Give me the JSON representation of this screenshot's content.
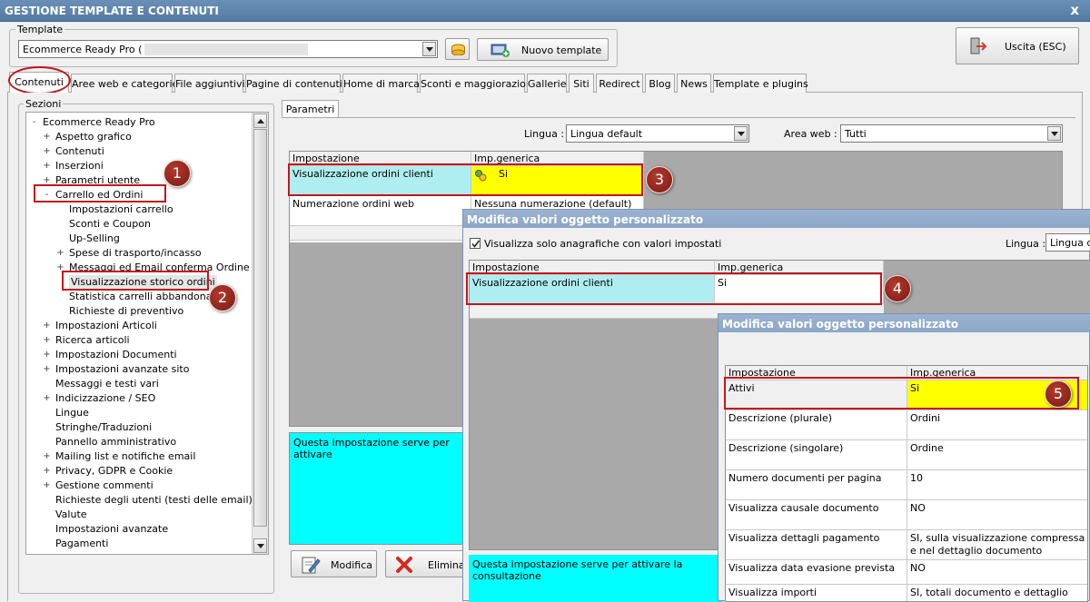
{
  "window": {
    "title": "GESTIONE TEMPLATE E CONTENUTI",
    "close": "x"
  },
  "template": {
    "label": "Template",
    "value": "Ecommerce Ready Pro (",
    "new_template": "Nuovo template",
    "exit": "Uscita (ESC)"
  },
  "tabs": [
    "Contenuti",
    "Aree web e categorie",
    "File aggiuntivi",
    "Pagine di contenuti",
    "Home di marca",
    "Sconti e maggiorazioni",
    "Gallerie",
    "Siti",
    "Redirect",
    "Blog",
    "News",
    "Template e plugins"
  ],
  "sections": {
    "label": "Sezioni",
    "items": [
      {
        "text": "Ecommerce Ready Pro",
        "level": 0,
        "exp": "-"
      },
      {
        "text": "Aspetto grafico",
        "level": 1,
        "exp": "+"
      },
      {
        "text": "Contenuti",
        "level": 1,
        "exp": "+"
      },
      {
        "text": "Inserzioni",
        "level": 1,
        "exp": "+"
      },
      {
        "text": "Parametri utente",
        "level": 1,
        "exp": "+"
      },
      {
        "text": "Carrello ed Ordini",
        "level": 1,
        "exp": "-"
      },
      {
        "text": "Impostazioni carrello",
        "level": 2,
        "exp": ""
      },
      {
        "text": "Sconti e Coupon",
        "level": 2,
        "exp": ""
      },
      {
        "text": "Up-Selling",
        "level": 2,
        "exp": ""
      },
      {
        "text": "Spese di trasporto/incasso",
        "level": 2,
        "exp": "+"
      },
      {
        "text": "Messaggi ed Email conferma Ordine",
        "level": 2,
        "exp": "+"
      },
      {
        "text": "Visualizzazione storico ordini",
        "level": 2,
        "exp": ""
      },
      {
        "text": "Statistica carrelli abbandonati",
        "level": 2,
        "exp": ""
      },
      {
        "text": "Richieste di preventivo",
        "level": 2,
        "exp": ""
      },
      {
        "text": "Impostazioni Articoli",
        "level": 1,
        "exp": "+"
      },
      {
        "text": "Ricerca articoli",
        "level": 1,
        "exp": "+"
      },
      {
        "text": "Impostazioni Documenti",
        "level": 1,
        "exp": "+"
      },
      {
        "text": "Impostazioni avanzate sito",
        "level": 1,
        "exp": "+"
      },
      {
        "text": "Messaggi e testi vari",
        "level": 1,
        "exp": ""
      },
      {
        "text": "Indicizzazione / SEO",
        "level": 1,
        "exp": "+"
      },
      {
        "text": "Lingue",
        "level": 1,
        "exp": ""
      },
      {
        "text": "Stringhe/Traduzioni",
        "level": 1,
        "exp": ""
      },
      {
        "text": "Pannello amministrativo",
        "level": 1,
        "exp": ""
      },
      {
        "text": "Mailing list e notifiche email",
        "level": 1,
        "exp": "+"
      },
      {
        "text": "Privacy, GDPR e Cookie",
        "level": 1,
        "exp": "+"
      },
      {
        "text": "Gestione commenti",
        "level": 1,
        "exp": "+"
      },
      {
        "text": "Richieste degli utenti (testi delle email)",
        "level": 1,
        "exp": ""
      },
      {
        "text": "Valute",
        "level": 1,
        "exp": ""
      },
      {
        "text": "Impostazioni avanzate",
        "level": 1,
        "exp": ""
      },
      {
        "text": "Pagamenti",
        "level": 1,
        "exp": ""
      }
    ]
  },
  "params": {
    "tab": "Parametri",
    "lingua_label": "Lingua :",
    "lingua_value": "Lingua default",
    "area_label": "Area web :",
    "area_value": "Tutti",
    "col_setting": "Impostazione",
    "col_generic": "Imp.generica",
    "rows": [
      {
        "setting": "Visualizzazione ordini clienti",
        "value": "Si"
      },
      {
        "setting": "Numerazione ordini web",
        "value": "Nessuna numerazione (default)"
      }
    ],
    "description": "Questa impostazione serve per attivare",
    "modify": "Modifica",
    "delete": "Elimina"
  },
  "dialog1": {
    "title": "Modifica valori oggetto personalizzato",
    "checkbox": "Visualizza solo anagrafiche con valori impostati",
    "lingua_label": "Lingua :",
    "lingua_value": "Lingua de",
    "col_setting": "Impostazione",
    "col_generic": "Imp.generica",
    "row_setting": "Visualizzazione ordini clienti",
    "row_value": "Si",
    "description": "Questa impostazione serve per attivare la consultazione"
  },
  "dialog2": {
    "title": "Modifica valori oggetto personalizzato",
    "col_setting": "Impostazione",
    "col_generic": "Imp.generica",
    "rows": [
      {
        "setting": "Attivi",
        "value": "Si"
      },
      {
        "setting": "Descrizione (plurale)",
        "value": "Ordini"
      },
      {
        "setting": "Descrizione (singolare)",
        "value": "Ordine"
      },
      {
        "setting": "Numero documenti per pagina",
        "value": "10"
      },
      {
        "setting": "Visualizza causale documento",
        "value": "NO"
      },
      {
        "setting": "Visualizza dettagli pagamento",
        "value": "SI, sulla visualizzazione compressa e nel dettaglio documento (comprese..."
      },
      {
        "setting": "Visualizza data evasione prevista",
        "value": "NO"
      },
      {
        "setting": "Visualizza importi",
        "value": "SI, totali documento e dettaglio"
      }
    ]
  },
  "badges": [
    "1",
    "2",
    "3",
    "4",
    "5"
  ],
  "colors": {
    "highlight": "#ffff00",
    "selection": "#aeeef0",
    "description": "#00ffff",
    "annotation": "#c4161c"
  }
}
